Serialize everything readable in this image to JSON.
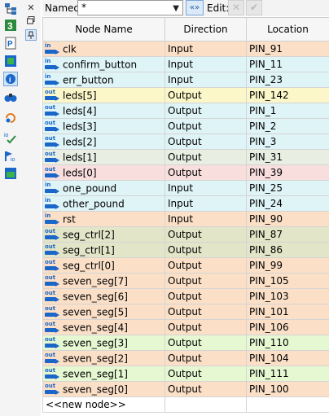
{
  "toolbar": {
    "icons": [
      "hierarchy-icon",
      "number-3-icon",
      "p-chip-icon",
      "node-icon",
      "info-icon",
      "binoculars-icon",
      "refresh-icon",
      "io-check-icon",
      "io-flag-icon",
      "device-icon"
    ]
  },
  "filter": {
    "named_label": "Named:",
    "named_value": "*",
    "edit_label": "Edit:",
    "refine_symbol": "«»",
    "cancel_symbol": "✕",
    "accept_symbol": "✔"
  },
  "columns": [
    "Node Name",
    "Direction",
    "Location"
  ],
  "rows": [
    {
      "dir_tag": "in",
      "name": "clk",
      "direction": "Input",
      "location": "PIN_91",
      "bg": "#fbdfc7"
    },
    {
      "dir_tag": "in",
      "name": "confirm_button",
      "direction": "Input",
      "location": "PIN_11",
      "bg": "#dff4f7"
    },
    {
      "dir_tag": "in",
      "name": "err_button",
      "direction": "Input",
      "location": "PIN_23",
      "bg": "#dff4f7"
    },
    {
      "dir_tag": "out",
      "name": "leds[5]",
      "direction": "Output",
      "location": "PIN_142",
      "bg": "#fbf7c9"
    },
    {
      "dir_tag": "out",
      "name": "leds[4]",
      "direction": "Output",
      "location": "PIN_1",
      "bg": "#dff4f7"
    },
    {
      "dir_tag": "out",
      "name": "leds[3]",
      "direction": "Output",
      "location": "PIN_2",
      "bg": "#dff4f7"
    },
    {
      "dir_tag": "out",
      "name": "leds[2]",
      "direction": "Output",
      "location": "PIN_3",
      "bg": "#dff4f7"
    },
    {
      "dir_tag": "out",
      "name": "leds[1]",
      "direction": "Output",
      "location": "PIN_31",
      "bg": "#e9eee3"
    },
    {
      "dir_tag": "out",
      "name": "leds[0]",
      "direction": "Output",
      "location": "PIN_39",
      "bg": "#f9dede"
    },
    {
      "dir_tag": "in",
      "name": "one_pound",
      "direction": "Input",
      "location": "PIN_25",
      "bg": "#dff4f7"
    },
    {
      "dir_tag": "in",
      "name": "other_pound",
      "direction": "Input",
      "location": "PIN_24",
      "bg": "#dff4f7"
    },
    {
      "dir_tag": "in",
      "name": "rst",
      "direction": "Input",
      "location": "PIN_90",
      "bg": "#fbdfc7"
    },
    {
      "dir_tag": "out",
      "name": "seg_ctrl[2]",
      "direction": "Output",
      "location": "PIN_87",
      "bg": "#e3e5c8"
    },
    {
      "dir_tag": "out",
      "name": "seg_ctrl[1]",
      "direction": "Output",
      "location": "PIN_86",
      "bg": "#e3e5c8"
    },
    {
      "dir_tag": "out",
      "name": "seg_ctrl[0]",
      "direction": "Output",
      "location": "PIN_99",
      "bg": "#fbdfc7"
    },
    {
      "dir_tag": "out",
      "name": "seven_seg[7]",
      "direction": "Output",
      "location": "PIN_105",
      "bg": "#fbdfc7"
    },
    {
      "dir_tag": "out",
      "name": "seven_seg[6]",
      "direction": "Output",
      "location": "PIN_103",
      "bg": "#fbdfc7"
    },
    {
      "dir_tag": "out",
      "name": "seven_seg[5]",
      "direction": "Output",
      "location": "PIN_101",
      "bg": "#fbdfc7"
    },
    {
      "dir_tag": "out",
      "name": "seven_seg[4]",
      "direction": "Output",
      "location": "PIN_106",
      "bg": "#fbdfc7"
    },
    {
      "dir_tag": "out",
      "name": "seven_seg[3]",
      "direction": "Output",
      "location": "PIN_110",
      "bg": "#e5f8d2"
    },
    {
      "dir_tag": "out",
      "name": "seven_seg[2]",
      "direction": "Output",
      "location": "PIN_104",
      "bg": "#fbdfc7"
    },
    {
      "dir_tag": "out",
      "name": "seven_seg[1]",
      "direction": "Output",
      "location": "PIN_111",
      "bg": "#e5f8d2"
    },
    {
      "dir_tag": "out",
      "name": "seven_seg[0]",
      "direction": "Output",
      "location": "PIN_100",
      "bg": "#fbdfc7"
    }
  ],
  "new_node_label": "<<new node>>",
  "colors": {
    "accent": "#1a66c9"
  }
}
